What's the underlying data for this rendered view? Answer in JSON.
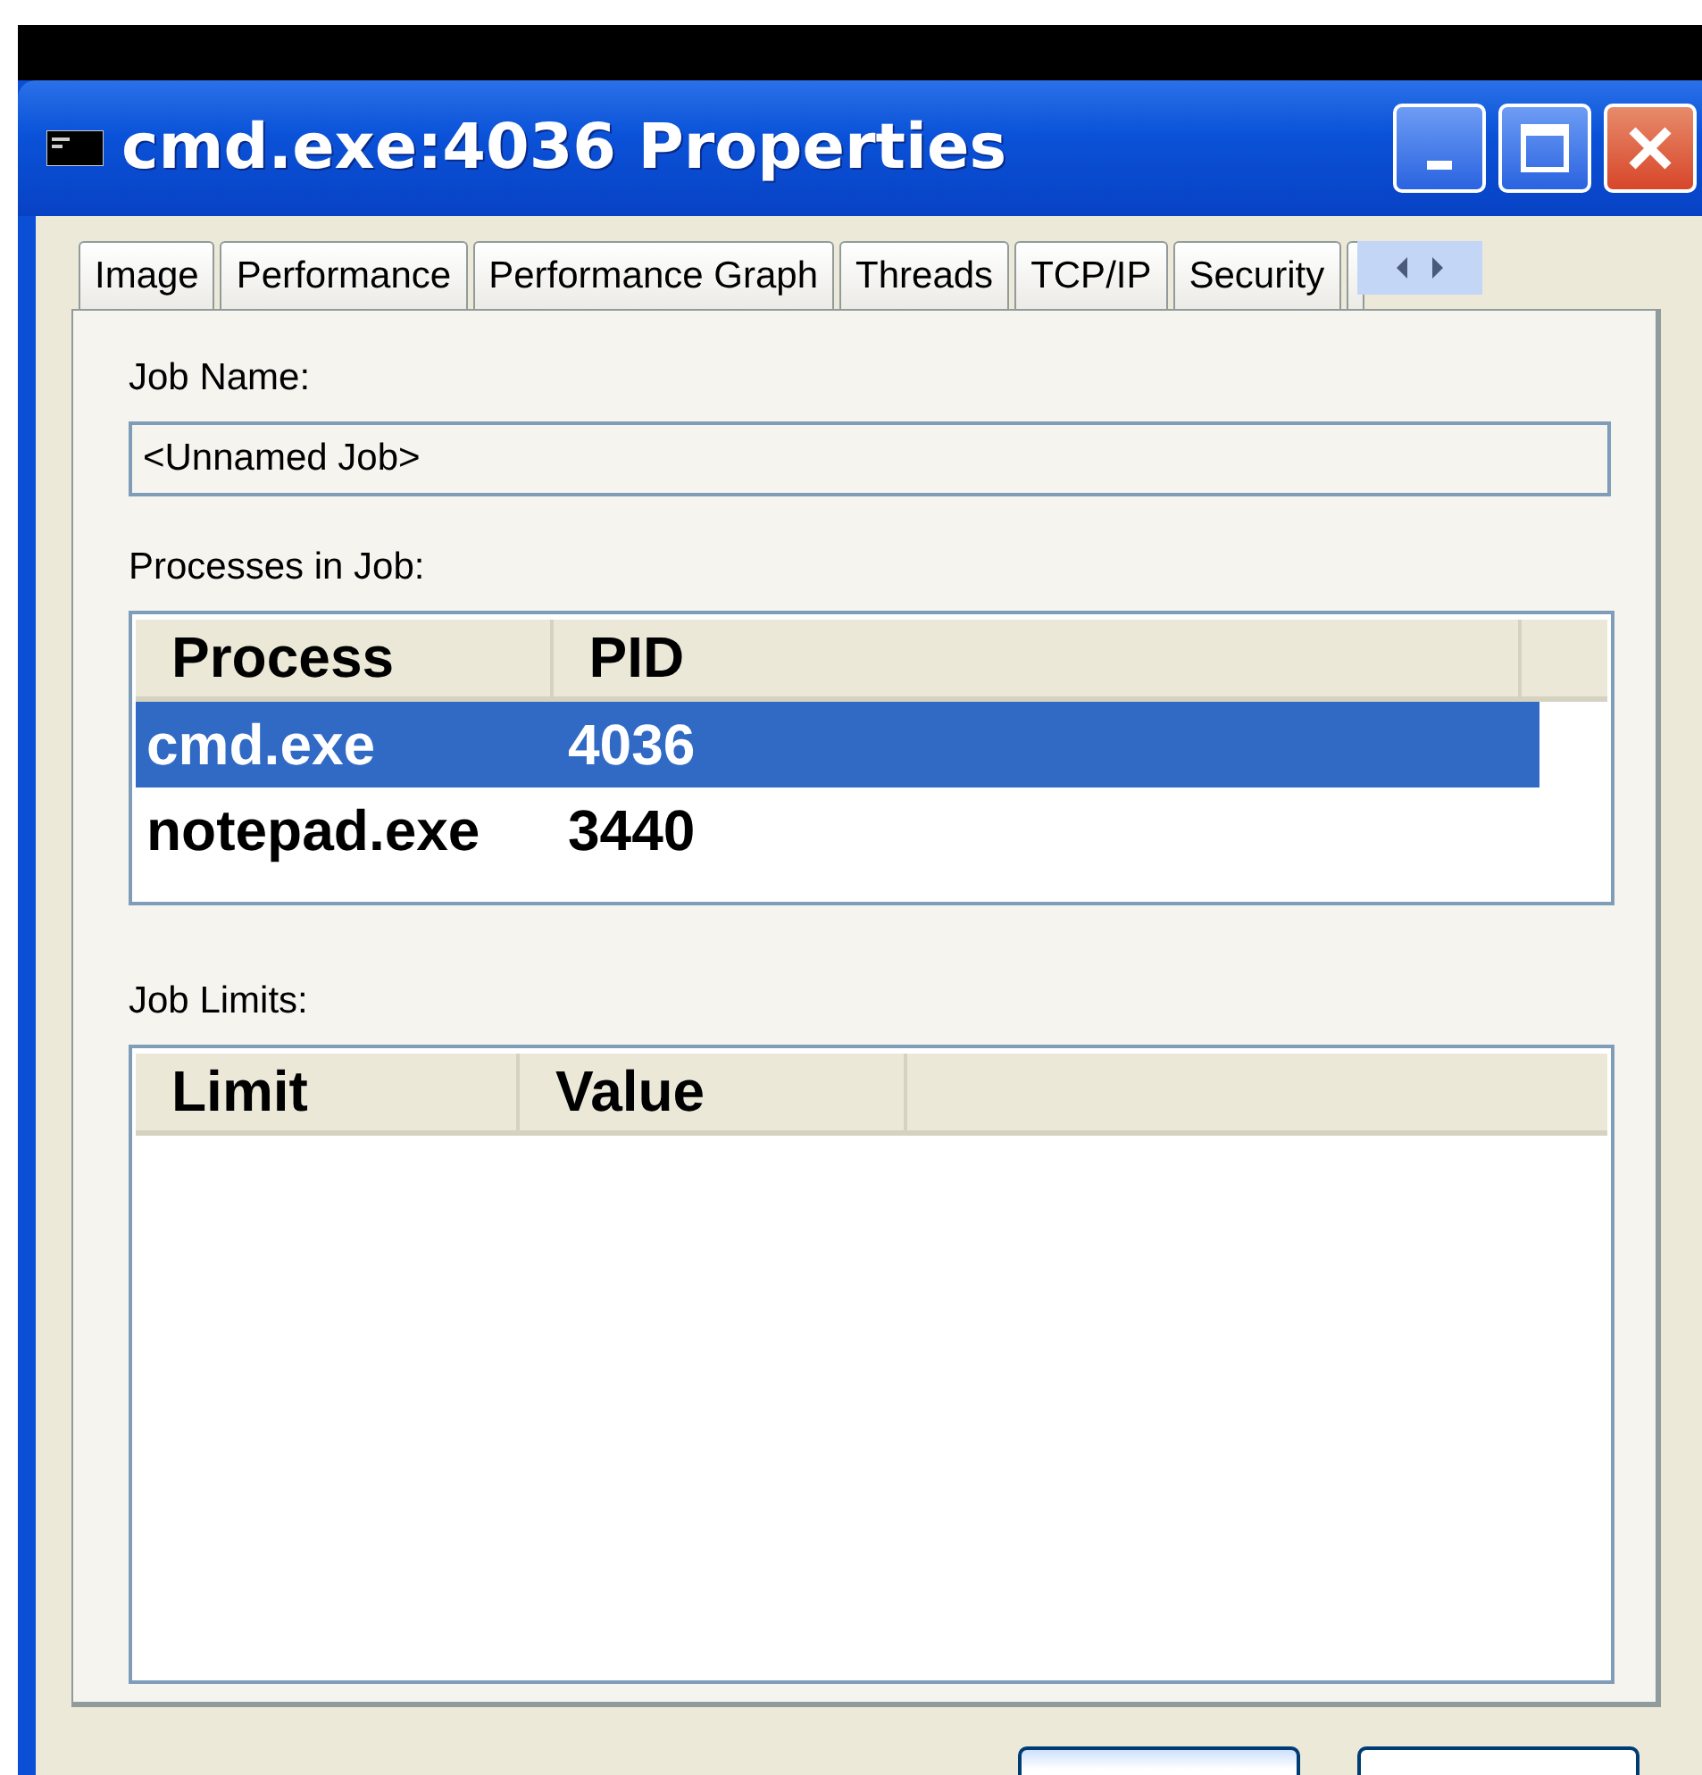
{
  "window": {
    "title": "cmd.exe:4036 Properties"
  },
  "tabs": [
    {
      "label": "Image",
      "selected": false
    },
    {
      "label": "Performance",
      "selected": false
    },
    {
      "label": "Performance Graph",
      "selected": false
    },
    {
      "label": "Threads",
      "selected": false
    },
    {
      "label": "TCP/IP",
      "selected": false
    },
    {
      "label": "Security",
      "selected": false
    }
  ],
  "job_name": {
    "label": "Job Name:",
    "value": "<Unnamed Job>"
  },
  "processes": {
    "label": "Processes in Job:",
    "columns": [
      "Process",
      "PID"
    ],
    "rows": [
      {
        "cells": [
          "cmd.exe",
          "4036"
        ],
        "selected": true
      },
      {
        "cells": [
          "notepad.exe",
          "3440"
        ],
        "selected": false
      }
    ]
  },
  "job_limits": {
    "label": "Job Limits:",
    "columns": [
      "Limit",
      "Value"
    ]
  }
}
